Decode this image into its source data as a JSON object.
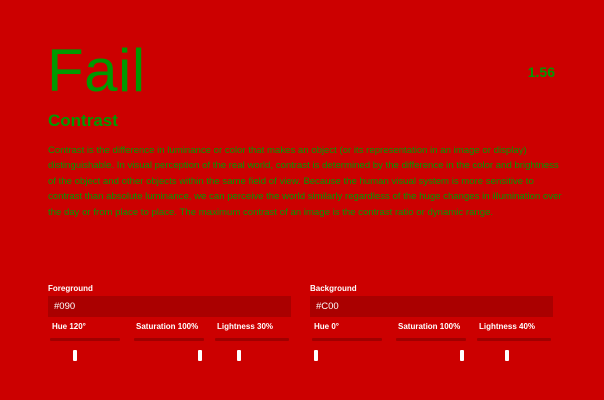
{
  "result": {
    "verdict": "Fail",
    "ratio": "1.56"
  },
  "content": {
    "title": "Contrast",
    "description": "Contrast is the difference in luminance or color that makes an object (or its representation in an image or display) distinguishable. In visual perception of the real world, contrast is determined by the difference in the color and brightness of the object and other objects within the same field of view. Because the human visual system is more sensitive to contrast than absolute luminance, we can perceive the world similarly regardless of the huge changes in illumination over the day or from place to place. The maximum contrast of an image is the contrast ratio or dynamic range."
  },
  "foreground": {
    "label": "Foreground",
    "hex": "#090",
    "hue_label": "Hue 120°",
    "saturation_label": "Saturation 100%",
    "lightness_label": "Lightness 30%",
    "hue_level": 0.333,
    "saturation_level": 1.0,
    "lightness_level": 0.3
  },
  "background": {
    "label": "Background",
    "hex": "#C00",
    "hue_label": "Hue 0°",
    "saturation_label": "Saturation 100%",
    "lightness_label": "Lightness 40%",
    "hue_level": 0.0,
    "saturation_level": 1.0,
    "lightness_level": 0.4
  },
  "colors": {
    "foreground": "#009900",
    "background": "#CC0000"
  }
}
